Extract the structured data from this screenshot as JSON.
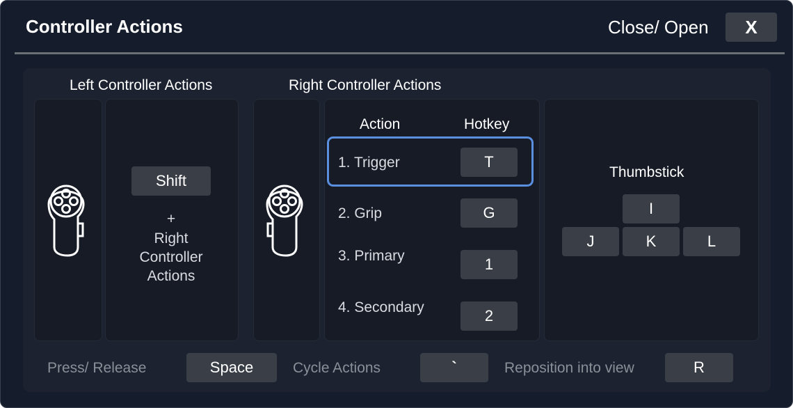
{
  "window": {
    "title": "Controller Actions",
    "close_label": "Close/ Open",
    "close_button": "X"
  },
  "left": {
    "section_title": "Left Controller Actions",
    "modifier_key": "Shift",
    "plus": "+",
    "note_line1": "Right",
    "note_line2": "Controller",
    "note_line3": "Actions"
  },
  "right": {
    "section_title": "Right Controller Actions",
    "col_action": "Action",
    "col_hotkey": "Hotkey",
    "actions": [
      {
        "label": "1. Trigger",
        "key": "T",
        "selected": true
      },
      {
        "label": "2. Grip",
        "key": "G"
      },
      {
        "label": "3. Primary",
        "key": "1"
      },
      {
        "label": "4. Secondary",
        "key": "2"
      }
    ]
  },
  "thumbstick": {
    "title": "Thumbstick",
    "up": "I",
    "left": "J",
    "down": "K",
    "right": "L"
  },
  "footer": {
    "press_label": "Press/ Release",
    "press_key": "Space",
    "cycle_label": "Cycle Actions",
    "cycle_key": "`",
    "reposition_label": "Reposition into view",
    "reposition_key": "R"
  },
  "colors": {
    "background": "#151c2b",
    "panel": "#1c2230",
    "key": "#3a3f47",
    "selection": "#5a8fe0"
  },
  "icons": [
    "vr-controller-icon",
    "vr-controller-icon"
  ]
}
